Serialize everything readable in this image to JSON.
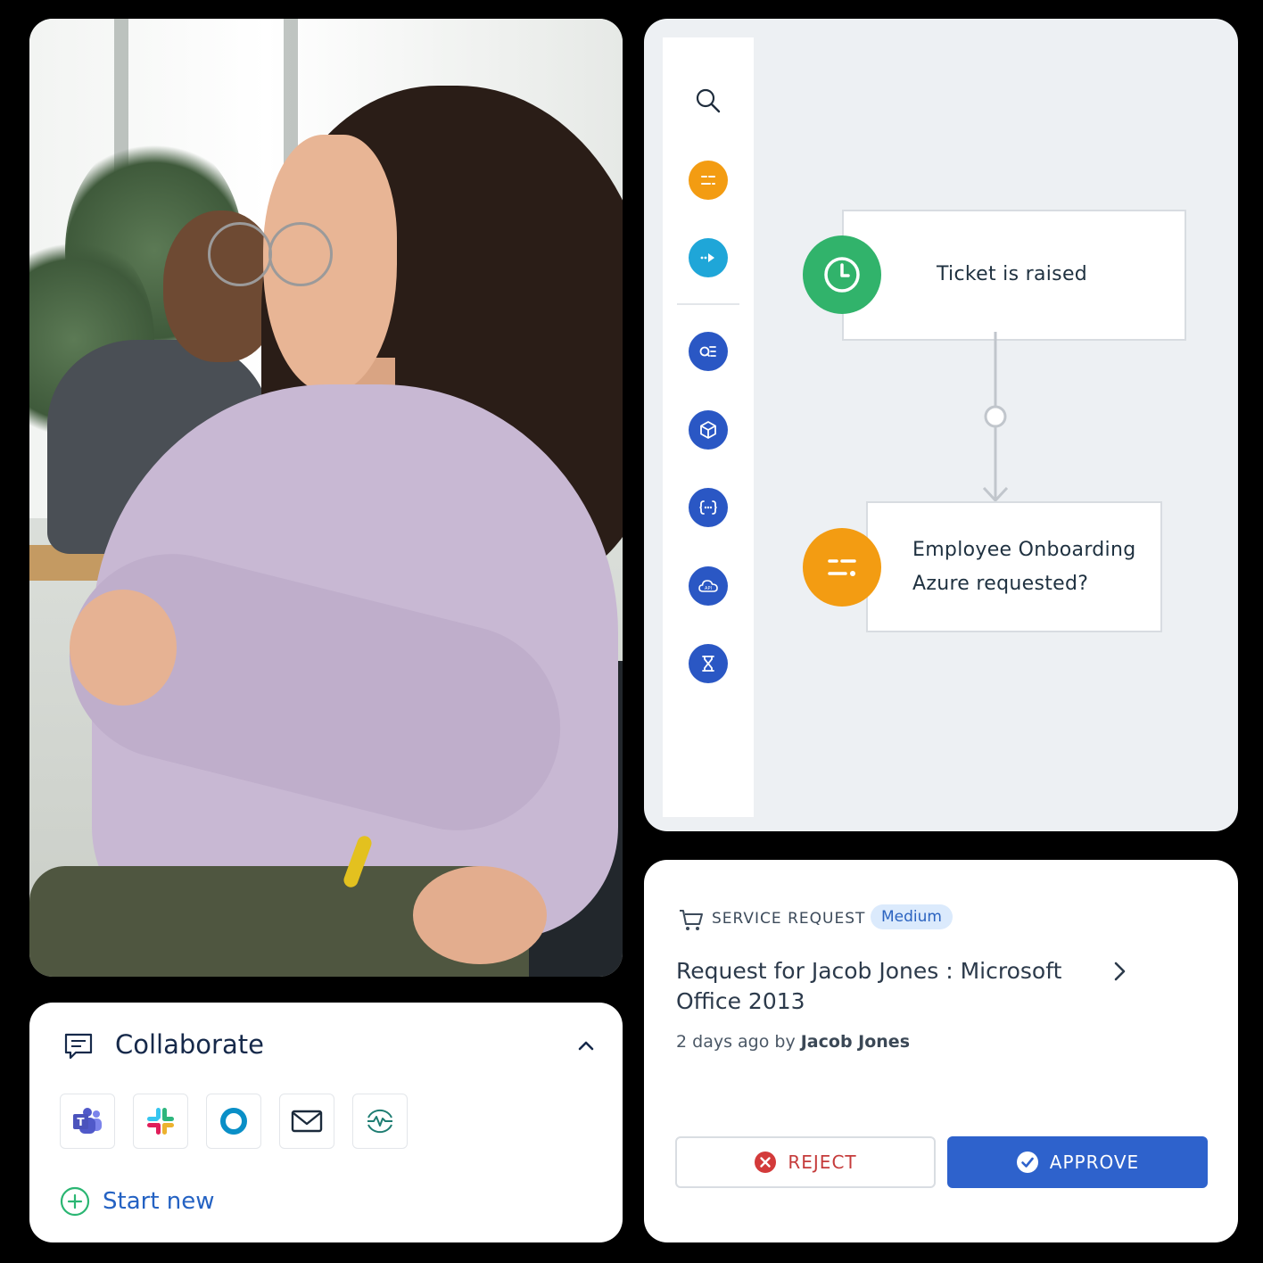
{
  "workflow": {
    "sidebar_icons": [
      "search-icon",
      "condition-icon",
      "action-icon",
      "query-icon",
      "package-icon",
      "code-icon",
      "api-cloud-icon",
      "hourglass-icon"
    ],
    "nodes": [
      {
        "label": "Ticket is raised",
        "icon": "clock-icon",
        "color": "#31b36b"
      },
      {
        "label_line1": "Employee Onboarding",
        "label_line2": "Azure requested?",
        "icon": "condition-icon",
        "color": "#f39c12"
      }
    ],
    "api_icon_label": "API"
  },
  "collaborate": {
    "title": "Collaborate",
    "apps": [
      "teams-icon",
      "slack-icon",
      "webex-icon",
      "email-icon",
      "monitor-icon"
    ],
    "start_new": "Start new"
  },
  "request": {
    "type": "SERVICE REQUEST",
    "priority": "Medium",
    "title": "Request for Jacob Jones : Microsoft Office 2013",
    "meta_prefix": "2 days ago by",
    "author": "Jacob Jones",
    "reject_label": "REJECT",
    "approve_label": "APPROVE"
  },
  "colors": {
    "accent": "#2e62cc",
    "reject": "#c53b3b",
    "green": "#31b36b",
    "orange": "#f39c12",
    "sidebar_blue": "#2a57c4",
    "sidebar_cyan": "#1fa6d8"
  }
}
